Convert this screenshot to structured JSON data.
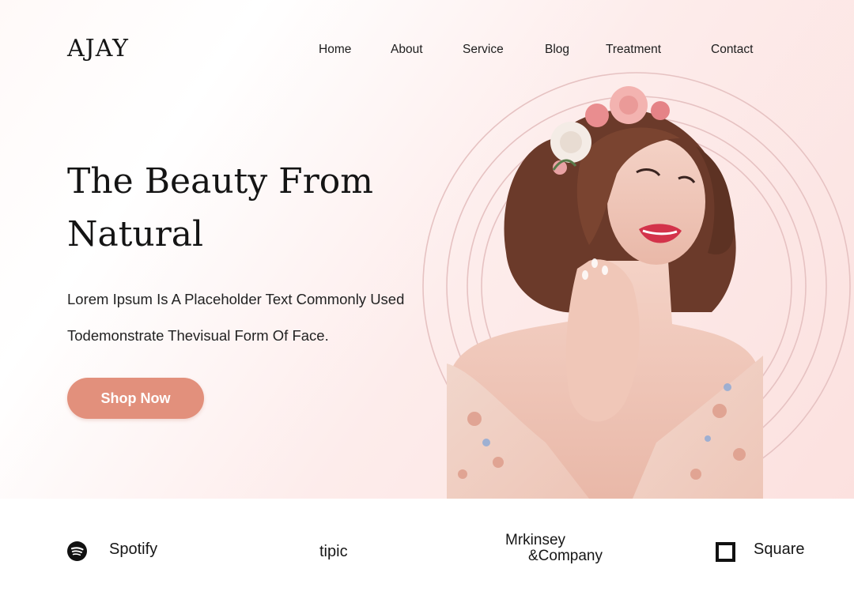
{
  "brand": {
    "logo": "AJAY"
  },
  "nav": {
    "items": [
      "Home",
      "About",
      "Service",
      "Blog",
      "Treatment",
      "Contact"
    ]
  },
  "hero": {
    "title": "The Beauty From Natural",
    "description": "Lorem Ipsum Is A Placeholder Text Commonly Used Todemonstrate Thevisual Form Of Face.",
    "cta_label": "Shop Now"
  },
  "partners": {
    "spotify": {
      "name": "Spotify",
      "icon": "spotify-icon"
    },
    "tipic": {
      "name": "tipic"
    },
    "mckinsey": {
      "line1": "Mrkinsey",
      "line2": "&Company"
    },
    "square": {
      "name": "Square",
      "icon": "square-icon"
    }
  },
  "colors": {
    "accent": "#e2907c",
    "hero_bg": "#fce6e4",
    "text": "#1b1b1b",
    "ring": "#e8c3c3"
  }
}
